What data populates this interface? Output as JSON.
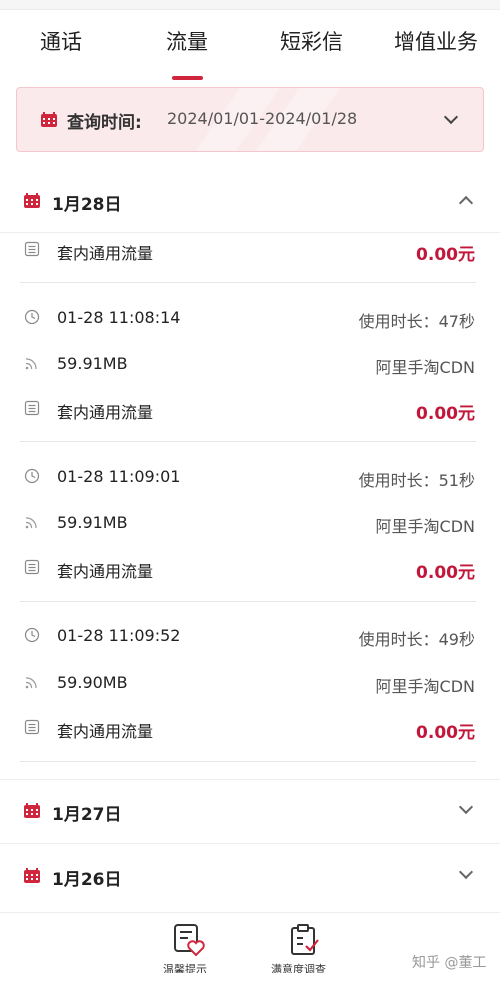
{
  "tabs": [
    "通话",
    "流量",
    "短彩信",
    "增值业务"
  ],
  "active_tab": "流量",
  "query": {
    "label": "查询时间:",
    "value": "2024/01/01-2024/01/28"
  },
  "days": [
    {
      "label": "1月28日",
      "expanded": true
    },
    {
      "label": "1月27日",
      "expanded": false
    },
    {
      "label": "1月26日",
      "expanded": false
    }
  ],
  "partial_record": {
    "package": "套内通用流量",
    "fee": "0.00元"
  },
  "records": [
    {
      "time": "01-28 11:08:14",
      "duration": "使用时长：47秒",
      "data": "59.91MB",
      "app": "阿里手淘CDN",
      "package": "套内通用流量",
      "fee": "0.00元"
    },
    {
      "time": "01-28 11:09:01",
      "duration": "使用时长：51秒",
      "data": "59.91MB",
      "app": "阿里手淘CDN",
      "package": "套内通用流量",
      "fee": "0.00元"
    },
    {
      "time": "01-28 11:09:52",
      "duration": "使用时长：49秒",
      "data": "59.90MB",
      "app": "阿里手淘CDN",
      "package": "套内通用流量",
      "fee": "0.00元"
    }
  ],
  "bottom_bar": {
    "reminder": "温馨提示",
    "survey": "满意度调查"
  },
  "watermark": "知乎 @董工",
  "colors": {
    "accent": "#d0263d",
    "price": "#c2173a",
    "query_bg": "#fbeaec"
  }
}
